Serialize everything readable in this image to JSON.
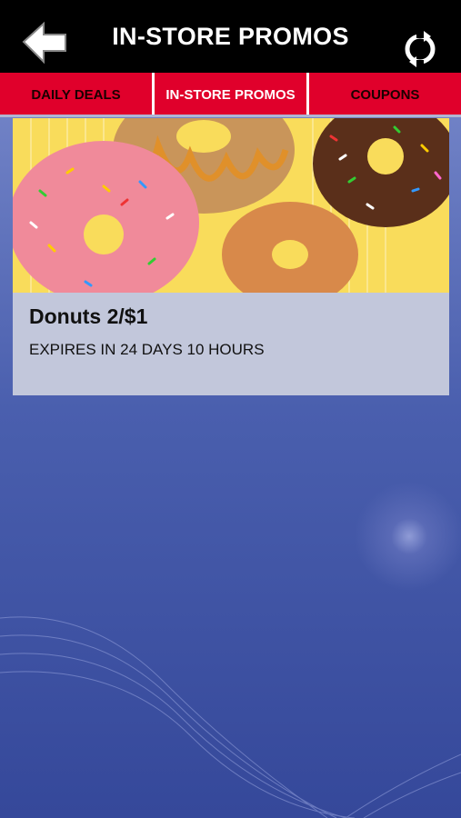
{
  "header": {
    "title": "IN-STORE PROMOS",
    "back_icon": "back-arrow-icon",
    "refresh_icon": "refresh-icon"
  },
  "tabs": [
    {
      "label": "DAILY DEALS",
      "active": false
    },
    {
      "label": "IN-STORE PROMOS",
      "active": true
    },
    {
      "label": "COUPONS",
      "active": false
    }
  ],
  "promo": {
    "title": "Donuts 2/$1",
    "expiry": "EXPIRES IN 24 DAYS 10 HOURS"
  },
  "colors": {
    "header_bg": "#000000",
    "tab_bg": "#e0002b",
    "card_bg": "#c2c7db",
    "page_bg": "#4a5fae",
    "image_bg": "#f9dc5b"
  }
}
